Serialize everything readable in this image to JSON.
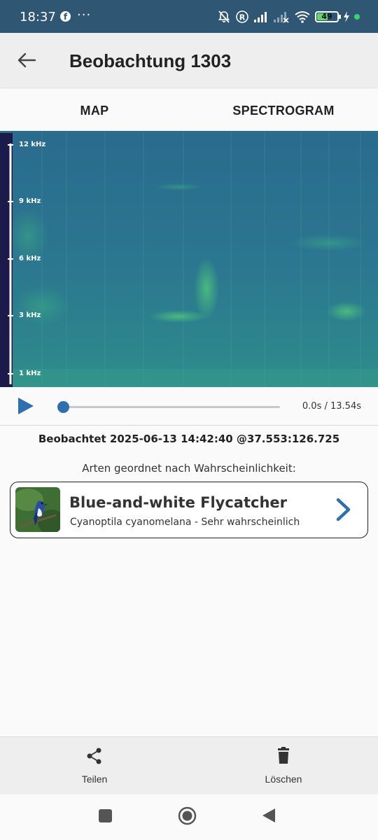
{
  "status_bar": {
    "time": "18:37",
    "more_indicator": "···",
    "battery_percent": "49",
    "icons": [
      "facebook-icon",
      "mute-icon",
      "registered-icon",
      "signal-icon",
      "signal-no-service-icon",
      "wifi-icon",
      "battery-icon",
      "charging-icon"
    ]
  },
  "app_bar": {
    "back_icon": "arrow-left-icon",
    "title": "Beobachtung 1303"
  },
  "tabs": [
    {
      "label": "MAP"
    },
    {
      "label": "SPECTROGRAM"
    }
  ],
  "spectrogram": {
    "freq_labels": [
      "12 kHz",
      "9 kHz",
      "6 kHz",
      "3 kHz",
      "1 kHz"
    ],
    "colors": {
      "background": "#2a6f8c",
      "highlight": "#46b97e",
      "axis": "#1b1a4a"
    }
  },
  "player": {
    "play_icon": "play-icon",
    "progress": 0,
    "time_text": "0.0s / 13.54s",
    "accent_color": "#2f6fad"
  },
  "observation": {
    "observed_text": "Beobachtet 2025-06-13 14:42:40 @37.553:126.725",
    "species_header": "Arten geordnet nach Wahrscheinlichkeit:"
  },
  "species": [
    {
      "common_name": "Blue-and-white Flycatcher",
      "scientific_line": "Cyanoptila cyanomelana - Sehr wahrscheinlich",
      "chevron_icon": "chevron-right-icon"
    }
  ],
  "bottom_actions": {
    "share_label": "Teilen",
    "delete_label": "Löschen"
  },
  "nav": {
    "icons": [
      "recents-square-icon",
      "home-circle-icon",
      "back-triangle-icon"
    ]
  }
}
